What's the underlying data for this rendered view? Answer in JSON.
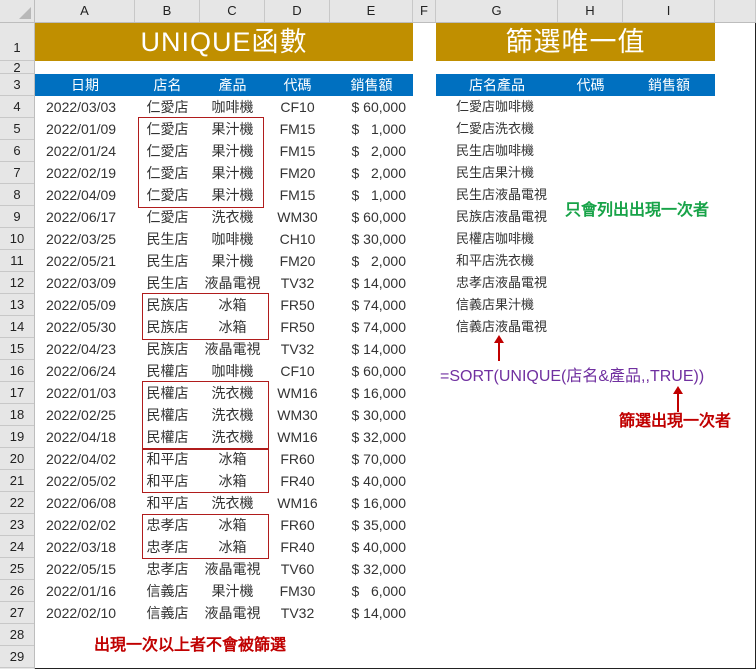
{
  "column_headers": [
    "A",
    "B",
    "C",
    "D",
    "E",
    "F",
    "G",
    "H",
    "I"
  ],
  "row_headers": [
    "1",
    "2",
    "3",
    "4",
    "5",
    "6",
    "7",
    "8",
    "9",
    "10",
    "11",
    "12",
    "13",
    "14",
    "15",
    "16",
    "17",
    "18",
    "19",
    "20",
    "21",
    "22",
    "23",
    "24",
    "25",
    "26",
    "27",
    "28",
    "29"
  ],
  "left_title": "UNIQUE函數",
  "right_title": "篩選唯一值",
  "left_table": {
    "headers": [
      "日期",
      "店名",
      "產品",
      "代碼",
      "銷售額"
    ],
    "rows": [
      [
        "2022/03/03",
        "仁愛店",
        "咖啡機",
        "CF10",
        "$ 60,000"
      ],
      [
        "2022/01/09",
        "仁愛店",
        "果汁機",
        "FM15",
        "$   1,000"
      ],
      [
        "2022/01/24",
        "仁愛店",
        "果汁機",
        "FM15",
        "$   2,000"
      ],
      [
        "2022/02/19",
        "仁愛店",
        "果汁機",
        "FM20",
        "$   2,000"
      ],
      [
        "2022/04/09",
        "仁愛店",
        "果汁機",
        "FM15",
        "$   1,000"
      ],
      [
        "2022/06/17",
        "仁愛店",
        "洗衣機",
        "WM30",
        "$ 60,000"
      ],
      [
        "2022/03/25",
        "民生店",
        "咖啡機",
        "CH10",
        "$ 30,000"
      ],
      [
        "2022/05/21",
        "民生店",
        "果汁機",
        "FM20",
        "$   2,000"
      ],
      [
        "2022/03/09",
        "民生店",
        "液晶電視",
        "TV32",
        "$ 14,000"
      ],
      [
        "2022/05/09",
        "民族店",
        "冰箱",
        "FR50",
        "$ 74,000"
      ],
      [
        "2022/05/30",
        "民族店",
        "冰箱",
        "FR50",
        "$ 74,000"
      ],
      [
        "2022/04/23",
        "民族店",
        "液晶電視",
        "TV32",
        "$ 14,000"
      ],
      [
        "2022/06/24",
        "民權店",
        "咖啡機",
        "CF10",
        "$ 60,000"
      ],
      [
        "2022/01/03",
        "民權店",
        "洗衣機",
        "WM16",
        "$ 16,000"
      ],
      [
        "2022/02/25",
        "民權店",
        "洗衣機",
        "WM30",
        "$ 30,000"
      ],
      [
        "2022/04/18",
        "民權店",
        "洗衣機",
        "WM16",
        "$ 32,000"
      ],
      [
        "2022/04/02",
        "和平店",
        "冰箱",
        "FR60",
        "$ 70,000"
      ],
      [
        "2022/05/02",
        "和平店",
        "冰箱",
        "FR40",
        "$ 40,000"
      ],
      [
        "2022/06/08",
        "和平店",
        "洗衣機",
        "WM16",
        "$ 16,000"
      ],
      [
        "2022/02/02",
        "忠孝店",
        "冰箱",
        "FR60",
        "$ 35,000"
      ],
      [
        "2022/03/18",
        "忠孝店",
        "冰箱",
        "FR40",
        "$ 40,000"
      ],
      [
        "2022/05/15",
        "忠孝店",
        "液晶電視",
        "TV60",
        "$ 32,000"
      ],
      [
        "2022/01/16",
        "信義店",
        "果汁機",
        "FM30",
        "$   6,000"
      ],
      [
        "2022/02/10",
        "信義店",
        "液晶電視",
        "TV32",
        "$ 14,000"
      ]
    ]
  },
  "right_table": {
    "headers": [
      "店名產品",
      "代碼",
      "銷售額"
    ],
    "items": [
      "仁愛店咖啡機",
      "仁愛店洗衣機",
      "民生店咖啡機",
      "民生店果汁機",
      "民生店液晶電視",
      "民族店液晶電視",
      "民權店咖啡機",
      "和平店洗衣機",
      "忠孝店液晶電視",
      "信義店果汁機",
      "信義店液晶電視"
    ]
  },
  "annotations": {
    "only_once": "只會列出出現一次者",
    "formula": "=SORT(UNIQUE(店名&產品,,TRUE))",
    "filter_once": "篩選出現一次者",
    "duplicates_note": "出現一次以上者不會被篩選"
  },
  "colors": {
    "title_bg": "#c08f00",
    "header_bg": "#0070c0",
    "highlight_box": "#b01c1c",
    "green_note": "#17a348",
    "red_note": "#c00000",
    "formula": "#7030a0"
  }
}
